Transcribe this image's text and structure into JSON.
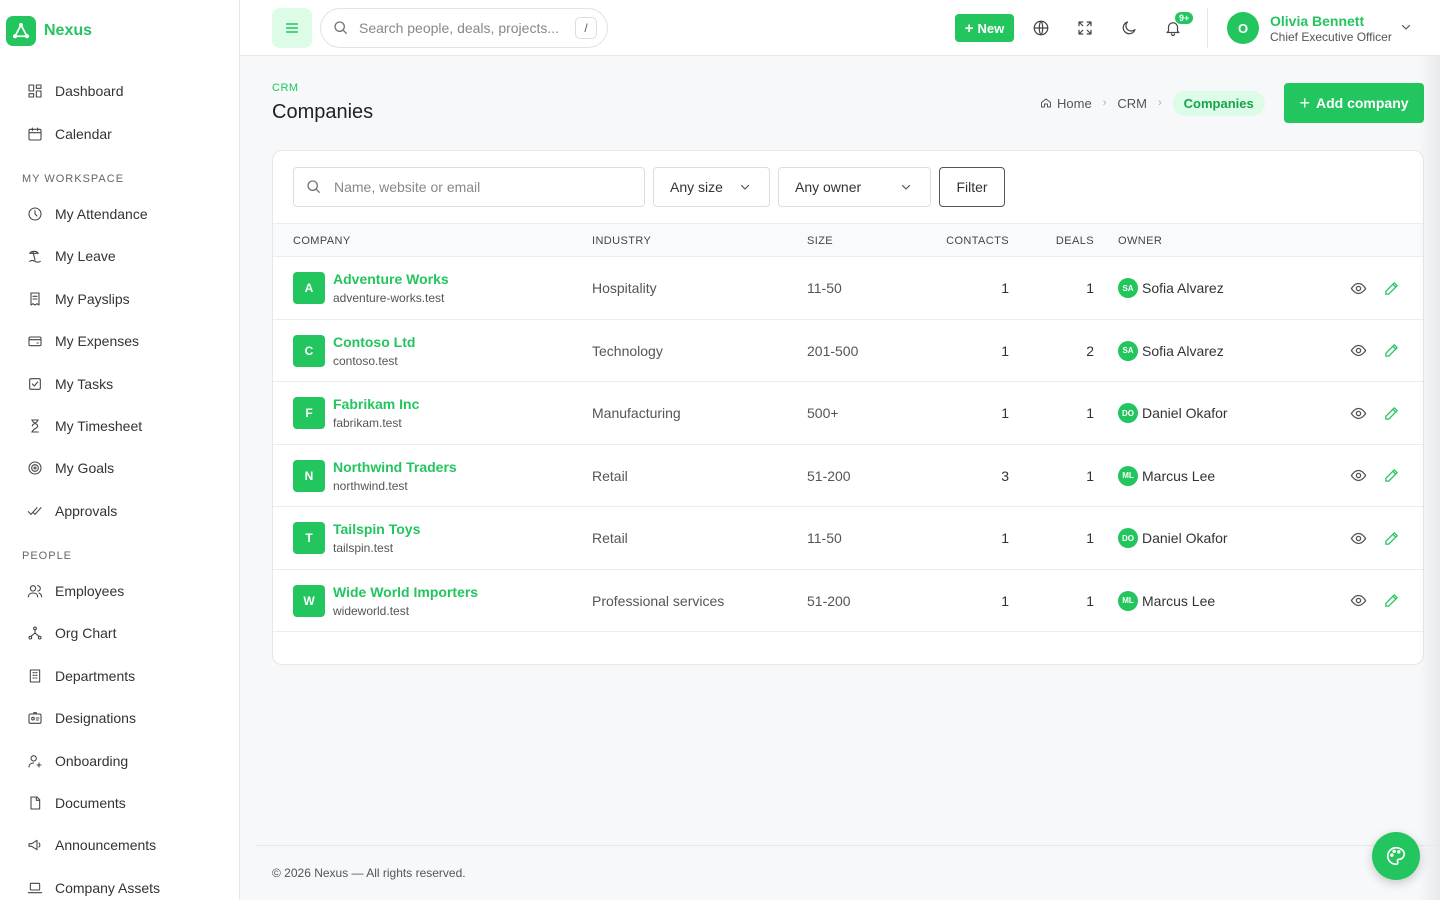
{
  "brand": {
    "name": "Nexus"
  },
  "sidebar": {
    "top": [
      {
        "label": "Dashboard",
        "icon": "dashboard-icon"
      },
      {
        "label": "Calendar",
        "icon": "calendar-icon"
      }
    ],
    "workspace_title": "MY WORKSPACE",
    "workspace": [
      {
        "label": "My Attendance",
        "icon": "clock-icon"
      },
      {
        "label": "My Leave",
        "icon": "beach-icon"
      },
      {
        "label": "My Payslips",
        "icon": "receipt-icon"
      },
      {
        "label": "My Expenses",
        "icon": "wallet-icon"
      },
      {
        "label": "My Tasks",
        "icon": "checkbox-icon"
      },
      {
        "label": "My Timesheet",
        "icon": "hourglass-icon"
      },
      {
        "label": "My Goals",
        "icon": "target-icon"
      },
      {
        "label": "Approvals",
        "icon": "double-check-icon"
      }
    ],
    "people_title": "PEOPLE",
    "people": [
      {
        "label": "Employees",
        "icon": "users-icon"
      },
      {
        "label": "Org Chart",
        "icon": "org-chart-icon"
      },
      {
        "label": "Departments",
        "icon": "building-icon"
      },
      {
        "label": "Designations",
        "icon": "id-card-icon"
      },
      {
        "label": "Onboarding",
        "icon": "user-plus-icon"
      },
      {
        "label": "Documents",
        "icon": "document-icon"
      },
      {
        "label": "Announcements",
        "icon": "megaphone-icon"
      },
      {
        "label": "Company Assets",
        "icon": "laptop-icon"
      }
    ]
  },
  "header": {
    "search_placeholder": "Search people, deals, projects...",
    "search_shortcut": "/",
    "new_label": "New",
    "notification_count": "9+",
    "user": {
      "initial": "O",
      "name": "Olivia Bennett",
      "role": "Chief Executive Officer"
    }
  },
  "page": {
    "eyebrow": "CRM",
    "title": "Companies",
    "breadcrumb": {
      "home": "Home",
      "crm": "CRM",
      "current": "Companies"
    },
    "add_label": "Add company"
  },
  "toolbar": {
    "search_placeholder": "Name, website or email",
    "size_select": "Any size",
    "owner_select": "Any owner",
    "filter_label": "Filter"
  },
  "table": {
    "headers": {
      "company": "COMPANY",
      "industry": "INDUSTRY",
      "size": "SIZE",
      "contacts": "CONTACTS",
      "deals": "DEALS",
      "owner": "OWNER"
    },
    "rows": [
      {
        "initial": "A",
        "name": "Adventure Works",
        "site": "adventure-works.test",
        "industry": "Hospitality",
        "size": "11-50",
        "contacts": "1",
        "deals": "1",
        "owner_initials": "SA",
        "owner": "Sofia Alvarez"
      },
      {
        "initial": "C",
        "name": "Contoso Ltd",
        "site": "contoso.test",
        "industry": "Technology",
        "size": "201-500",
        "contacts": "1",
        "deals": "2",
        "owner_initials": "SA",
        "owner": "Sofia Alvarez"
      },
      {
        "initial": "F",
        "name": "Fabrikam Inc",
        "site": "fabrikam.test",
        "industry": "Manufacturing",
        "size": "500+",
        "contacts": "1",
        "deals": "1",
        "owner_initials": "DO",
        "owner": "Daniel Okafor"
      },
      {
        "initial": "N",
        "name": "Northwind Traders",
        "site": "northwind.test",
        "industry": "Retail",
        "size": "51-200",
        "contacts": "3",
        "deals": "1",
        "owner_initials": "ML",
        "owner": "Marcus Lee"
      },
      {
        "initial": "T",
        "name": "Tailspin Toys",
        "site": "tailspin.test",
        "industry": "Retail",
        "size": "11-50",
        "contacts": "1",
        "deals": "1",
        "owner_initials": "DO",
        "owner": "Daniel Okafor"
      },
      {
        "initial": "W",
        "name": "Wide World Importers",
        "site": "wideworld.test",
        "industry": "Professional services",
        "size": "51-200",
        "contacts": "1",
        "deals": "1",
        "owner_initials": "ML",
        "owner": "Marcus Lee"
      }
    ]
  },
  "footer": {
    "text": "© 2026 Nexus — All rights reserved."
  },
  "colors": {
    "accent": "#22c55e",
    "accent_light": "#dcfce7"
  }
}
